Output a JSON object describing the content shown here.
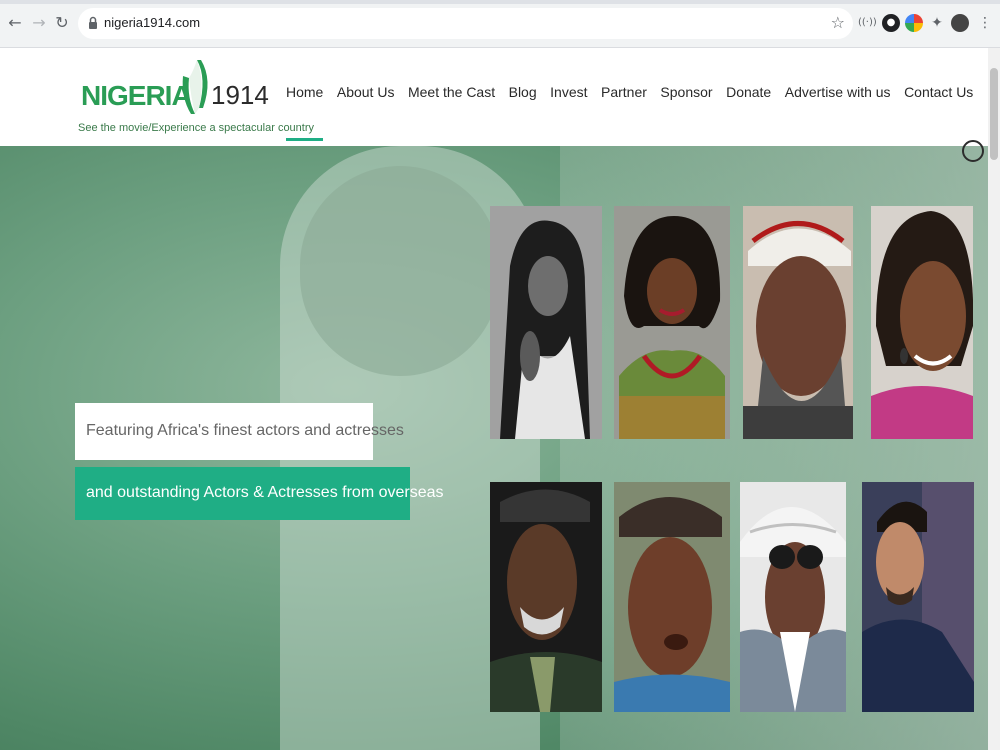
{
  "browser": {
    "url": "nigeria1914.com"
  },
  "logo": {
    "name": "NIGERIA",
    "year": "1914",
    "tagline": "See the movie/Experience a spectacular country"
  },
  "nav": {
    "items": [
      {
        "label": "Home"
      },
      {
        "label": "About Us"
      },
      {
        "label": "Meet the Cast"
      },
      {
        "label": "Blog"
      },
      {
        "label": "Invest"
      },
      {
        "label": "Partner"
      },
      {
        "label": "Sponsor"
      },
      {
        "label": "Donate"
      },
      {
        "label": "Advertise with us"
      },
      {
        "label": "Contact Us"
      }
    ],
    "active": "Home"
  },
  "hero": {
    "caption_primary": "Featuring Africa's finest actors and actresses",
    "caption_secondary": "and outstanding Actors & Actresses from overseas"
  },
  "colors": {
    "accent": "#1fae85",
    "logo_green": "#2a9d55",
    "hero_green": "#6c9f80"
  }
}
